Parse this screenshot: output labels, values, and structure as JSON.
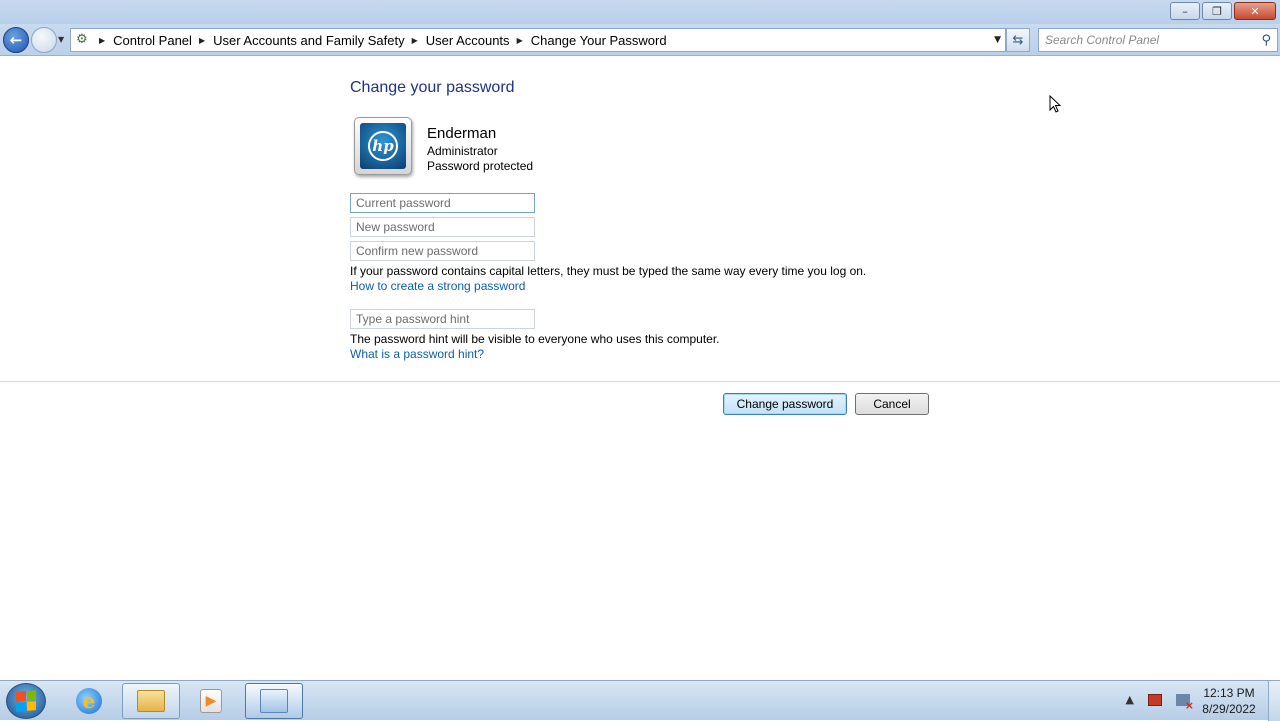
{
  "window": {
    "minimize_label": "▭",
    "restore_label": "❐",
    "close_label": "✕"
  },
  "navigation": {
    "back_label": "←",
    "breadcrumbs": [
      "Control Panel",
      "User Accounts and Family Safety",
      "User Accounts",
      "Change Your Password"
    ],
    "search_placeholder": "Search Control Panel"
  },
  "main": {
    "title": "Change your password",
    "user": {
      "name": "Enderman",
      "role": "Administrator",
      "status": "Password protected",
      "avatar_text": "hp"
    },
    "fields": {
      "current_password_placeholder": "Current password",
      "new_password_placeholder": "New password",
      "confirm_password_placeholder": "Confirm new password",
      "hint_placeholder": "Type a password hint"
    },
    "caps_note": "If your password contains capital letters, they must be typed the same way every time you log on.",
    "strong_password_link": "How to create a strong password",
    "hint_note": "The password hint will be visible to everyone who uses this computer.",
    "hint_link": "What is a password hint?",
    "change_button": "Change password",
    "cancel_button": "Cancel"
  },
  "taskbar": {
    "apps": [
      "internet-explorer",
      "windows-explorer",
      "media-player",
      "control-panel"
    ],
    "time": "12:13 PM",
    "date": "8/29/2022"
  }
}
